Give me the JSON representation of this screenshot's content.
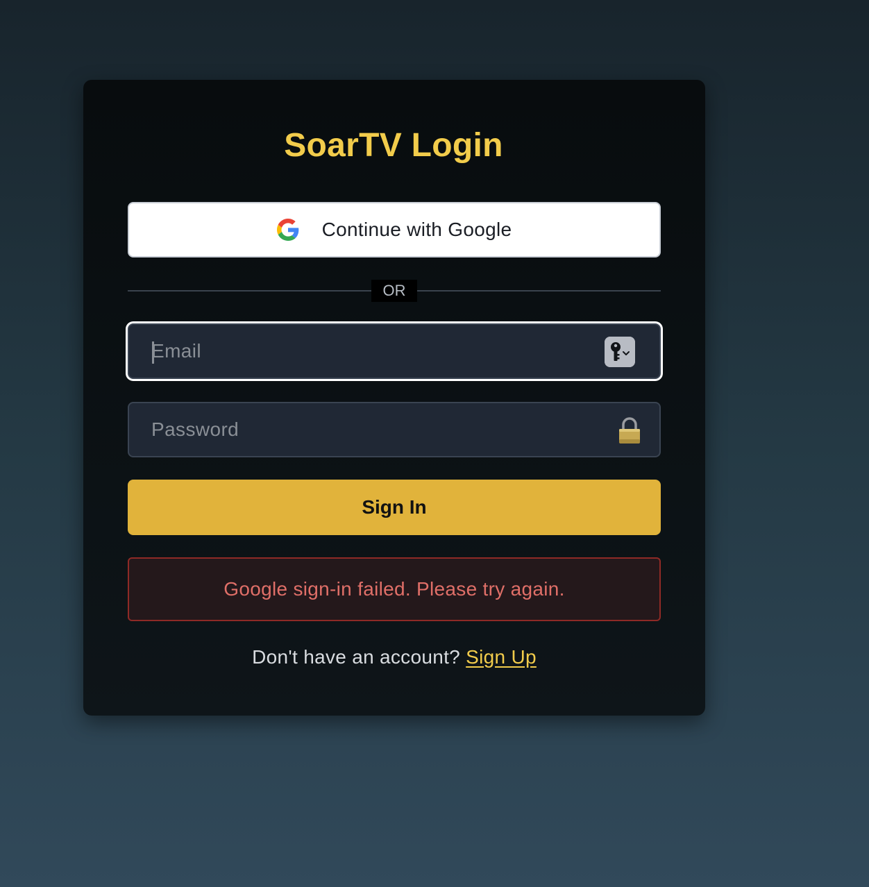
{
  "login": {
    "title": "SoarTV Login",
    "google_button": "Continue with Google",
    "divider": "OR",
    "email_placeholder": "Email",
    "password_placeholder": "Password",
    "sign_in_button": "Sign In",
    "error_message": "Google sign-in failed. Please try again.",
    "signup_prompt": "Don't have an account?",
    "signup_link": "Sign Up"
  },
  "icons": {
    "google": "google-g-logo",
    "password_manager": "key-icon",
    "password_field": "lock-icon"
  },
  "colors": {
    "accent": "#f2cc4b",
    "button": "#e1b33b",
    "error_text": "#e06f68",
    "error_border": "#8f2a26",
    "field_bg": "#202835"
  }
}
